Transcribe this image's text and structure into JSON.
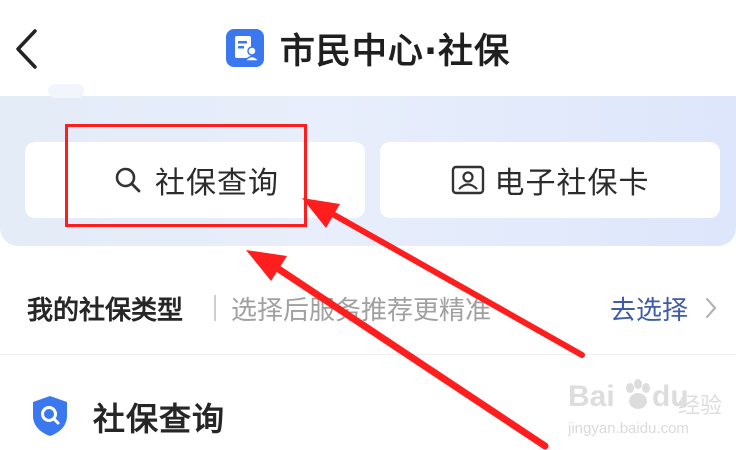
{
  "header": {
    "title": "市民中心·社保",
    "back_icon": "chevron-left-icon",
    "title_icon": "document-person-icon",
    "brand_color": "#3b78f0"
  },
  "quick_actions": [
    {
      "label": "社保查询",
      "icon": "search-icon"
    },
    {
      "label": "电子社保卡",
      "icon": "id-card-icon"
    }
  ],
  "type_row": {
    "label": "我的社保类型",
    "hint": "选择后服务推荐更精准",
    "action": "去选择",
    "action_icon": "chevron-right-icon",
    "action_color": "#3f5ca8"
  },
  "section": {
    "title": "社保查询",
    "icon": "shield-search-icon"
  },
  "annotation": {
    "highlight_color": "#ff1e1e",
    "arrow_color": "#ff1e1e"
  },
  "watermark": {
    "brand": "Bai",
    "suffix": "经验",
    "url": "jingyan.baidu.com"
  }
}
